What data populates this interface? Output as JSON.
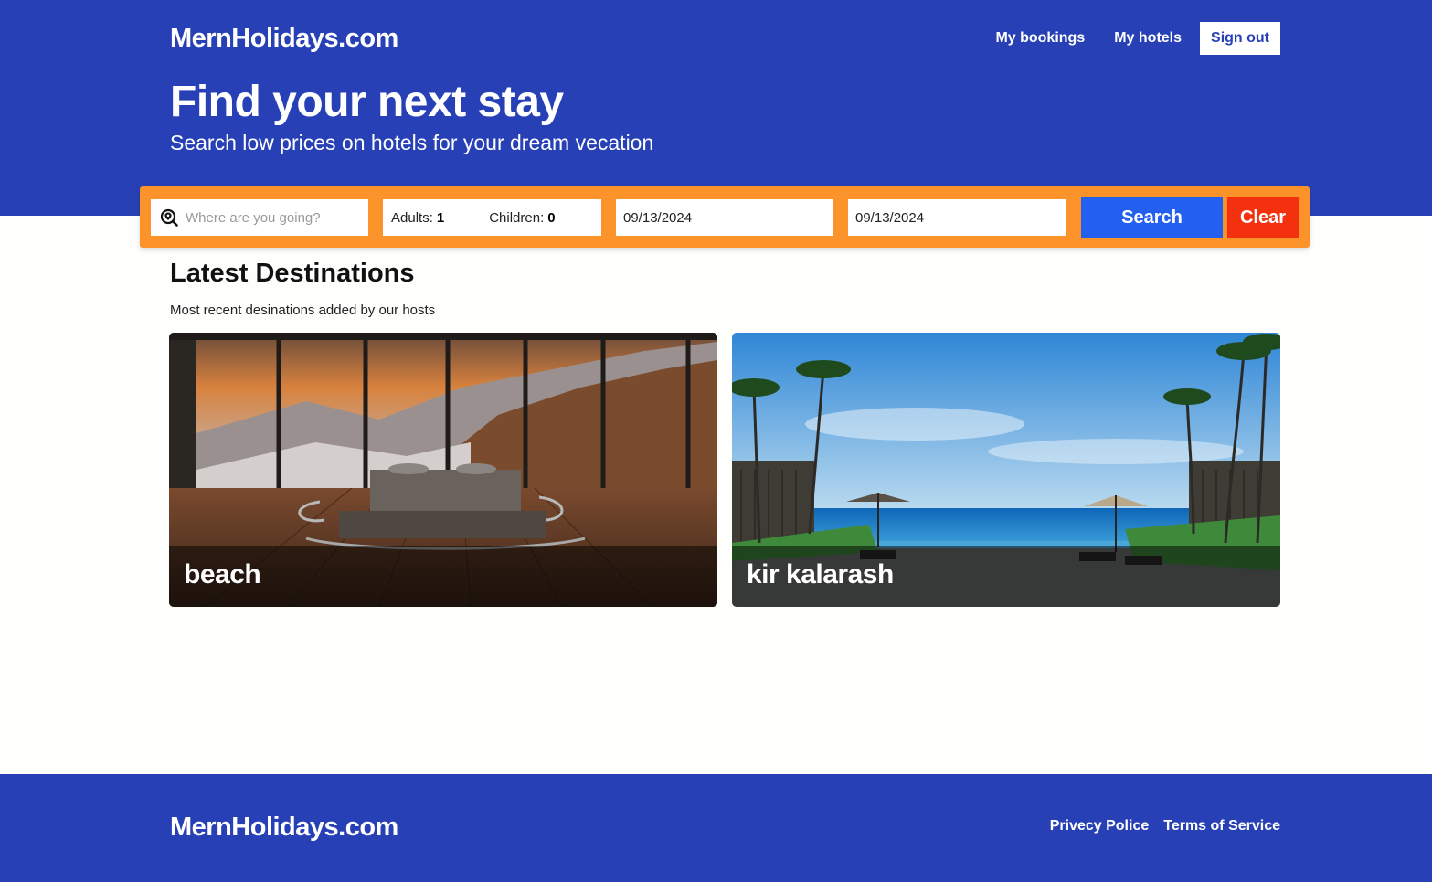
{
  "header": {
    "brand": "MernHolidays.com",
    "nav": {
      "my_bookings": "My bookings",
      "my_hotels": "My hotels",
      "sign_out": "Sign out"
    },
    "title": "Find your next stay",
    "subtitle": "Search low prices on hotels for your dream vecation"
  },
  "search": {
    "destination_placeholder": "Where are you going?",
    "destination_value": "",
    "adults_label": "Adults:",
    "adults_value": "1",
    "children_label": "Children:",
    "children_value": "0",
    "check_in": "09/13/2024",
    "check_out": "09/13/2024",
    "search_label": "Search",
    "clear_label": "Clear",
    "icon": "search-location-icon"
  },
  "destinations": {
    "title": "Latest Destinations",
    "subtitle": "Most recent desinations added by our hosts",
    "cards": [
      {
        "name": "beach"
      },
      {
        "name": "kir kalarash"
      }
    ]
  },
  "footer": {
    "brand": "MernHolidays.com",
    "links": {
      "privacy": "Privecy Police",
      "terms": "Terms of Service"
    }
  },
  "colors": {
    "brand_blue": "#2740b6",
    "search_bar": "#fb922a",
    "search_button": "#2460f0",
    "clear_button": "#f3310f"
  }
}
